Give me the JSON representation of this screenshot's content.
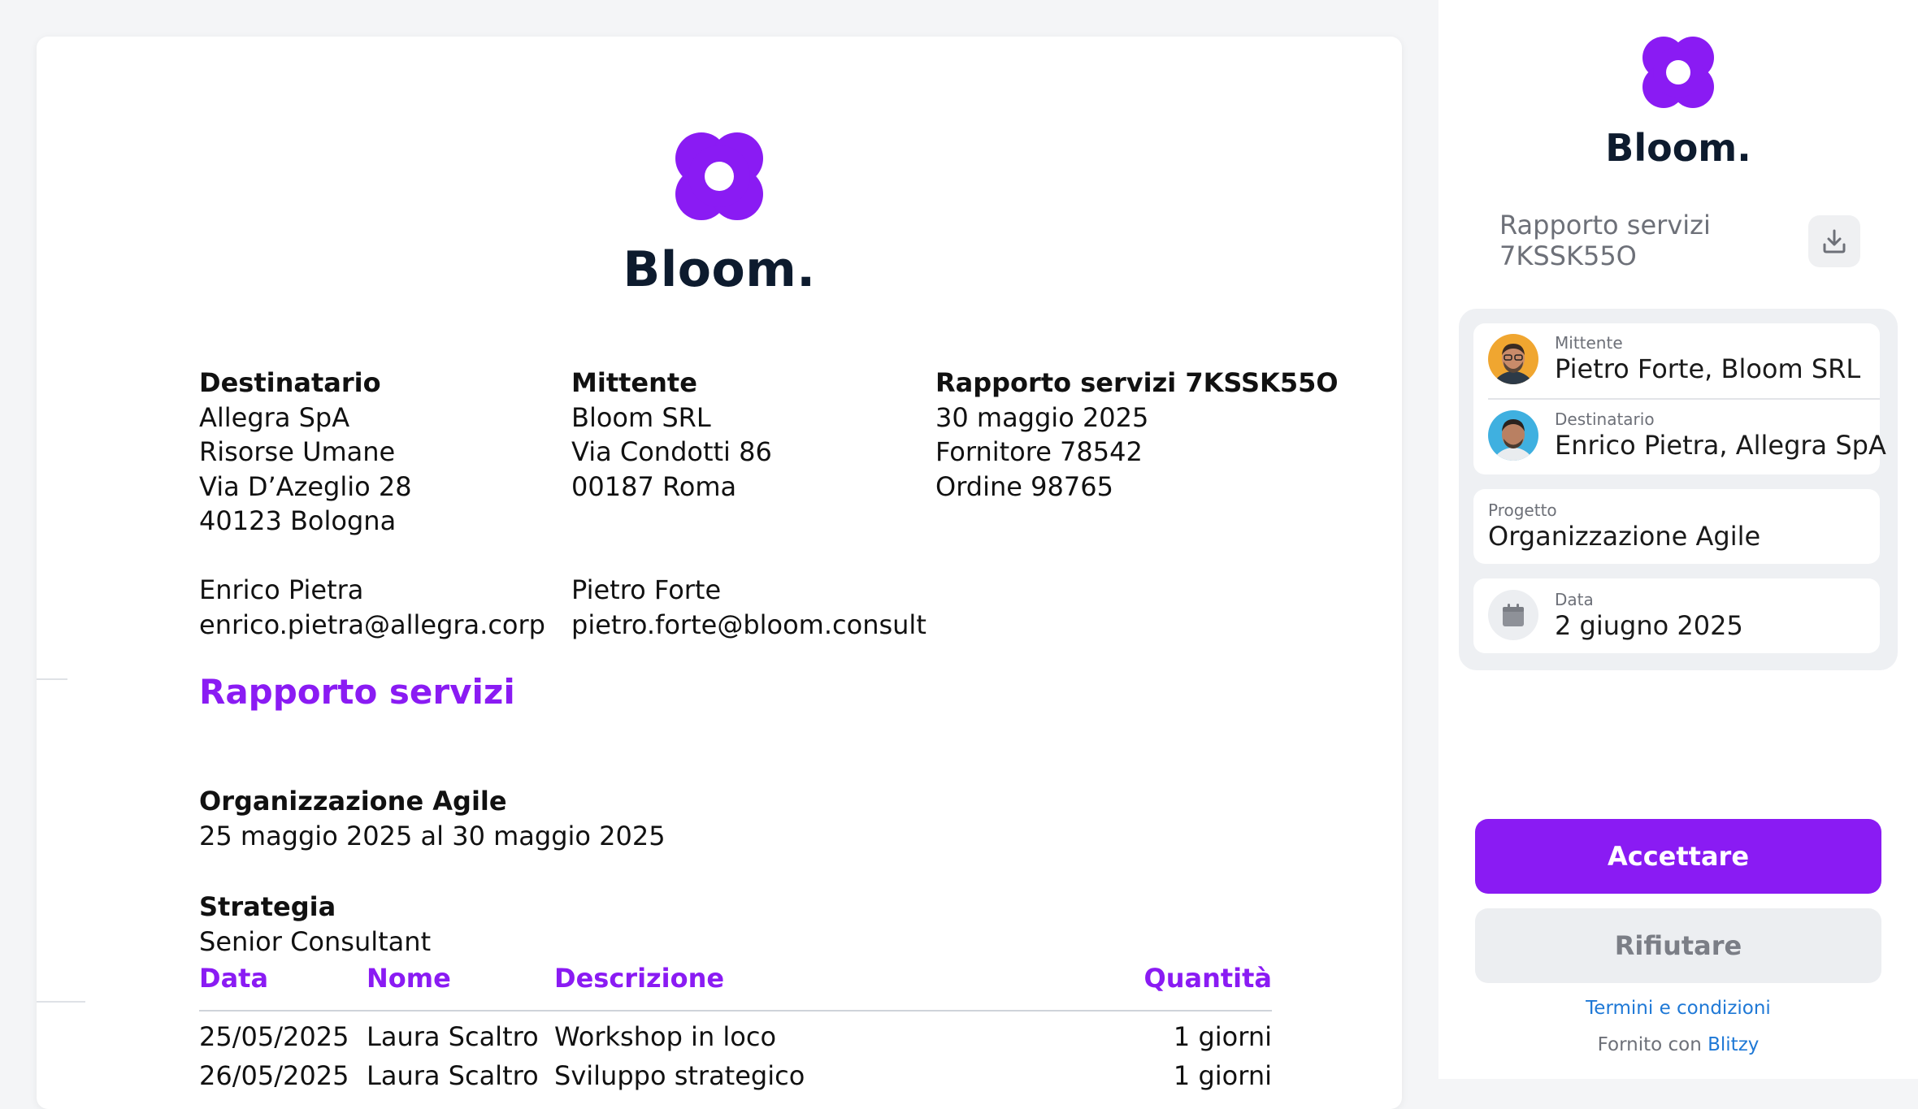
{
  "brand": {
    "name": "Bloom.",
    "color": "#8a1bf3",
    "logo_icon": "flower-icon"
  },
  "document": {
    "recipient": {
      "heading": "Destinatario",
      "lines": [
        "Allegra SpA",
        "Risorse Umane",
        "Via D’Azeglio 28",
        "40123 Bologna"
      ],
      "contact_name": "Enrico Pietra",
      "contact_email": "enrico.pietra@allegra.corp"
    },
    "sender": {
      "heading": "Mittente",
      "lines": [
        "Bloom SRL",
        "Via Condotti 86",
        "00187 Roma"
      ],
      "contact_name": "Pietro Forte",
      "contact_email": "pietro.forte@bloom.consult"
    },
    "report": {
      "heading": "Rapporto servizi 7KSSK55O",
      "lines": [
        "30 maggio 2025",
        "Fornitore 78542",
        "Ordine 98765"
      ]
    },
    "section_title": "Rapporto servizi",
    "project": {
      "title": "Organizzazione Agile",
      "period": "25 maggio 2025 al 30 maggio 2025"
    },
    "category": {
      "title": "Strategia",
      "role": "Senior Consultant"
    },
    "table": {
      "headers": {
        "date": "Data",
        "name": "Nome",
        "description": "Descrizione",
        "quantity": "Quantità"
      },
      "rows": [
        {
          "date": "25/05/2025",
          "name": "Laura Scaltro",
          "description": "Workshop in loco",
          "quantity": "1 giorni"
        },
        {
          "date": "26/05/2025",
          "name": "Laura Scaltro",
          "description": "Sviluppo strategico",
          "quantity": "1 giorni"
        }
      ]
    }
  },
  "sidebar": {
    "brand": "Bloom.",
    "doc_title": "Rapporto servizi 7KSSK55O",
    "download_icon": "download-icon",
    "sender": {
      "label": "Mittente",
      "value": "Pietro Forte, Bloom SRL"
    },
    "recipient": {
      "label": "Destinatario",
      "value": "Enrico Pietra, Allegra SpA"
    },
    "project": {
      "label": "Progetto",
      "value": "Organizzazione Agile"
    },
    "date": {
      "label": "Data",
      "value": "2 giugno 2025",
      "icon": "calendar-icon"
    },
    "accept_label": "Accettare",
    "reject_label": "Rifiutare",
    "terms_label": "Termini e condizioni",
    "powered_prefix": "Fornito con",
    "powered_link": "Blitzy"
  }
}
